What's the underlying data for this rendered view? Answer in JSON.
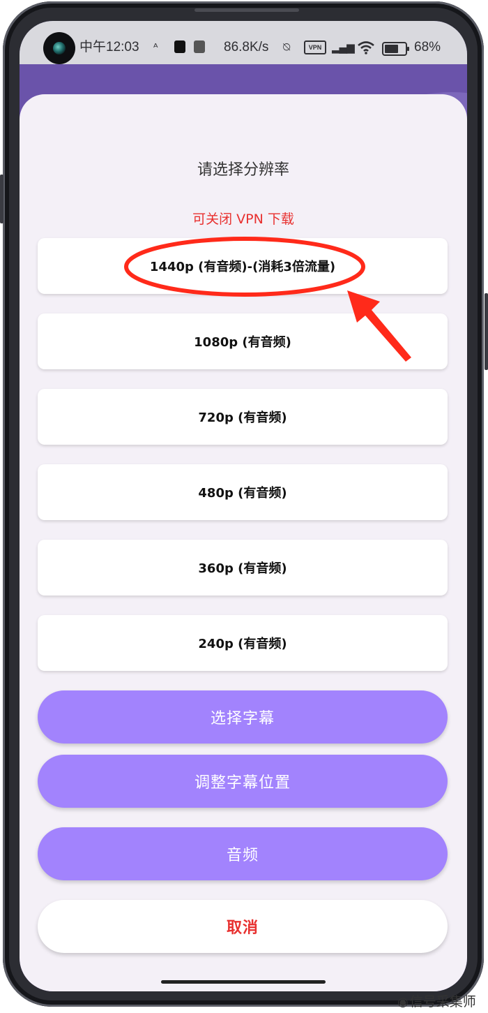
{
  "status_bar": {
    "time": "中午12:03",
    "net_speed": "86.8K/s",
    "vpn": "VPN",
    "battery": "68%",
    "battery_level": 0.68
  },
  "dialog": {
    "title": "请选择分辨率",
    "note": "可关闭 VPN 下载",
    "options": [
      "1440p (有音频)-(消耗3倍流量)",
      "1080p (有音频)",
      "720p (有音频)",
      "480p (有音频)",
      "360p (有音频)",
      "240p (有音频)"
    ],
    "actions": {
      "subtitle": "选择字幕",
      "adjust_subtitle": "调整字幕位置",
      "audio": "音频",
      "cancel": "取消"
    }
  },
  "watermark": "信号采集师",
  "colors": {
    "accent_purple": "#a283fd",
    "alert_red": "#e8302f",
    "header_purple": "#6a53aa",
    "annotation_red": "#ff2a1a"
  }
}
